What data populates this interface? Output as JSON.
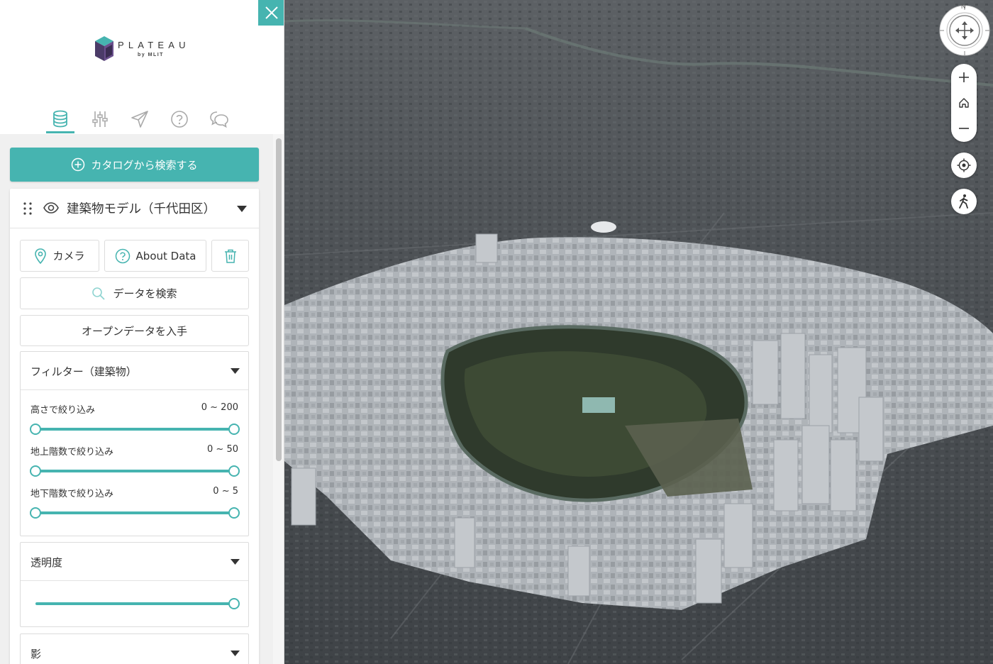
{
  "app": {
    "logo_text": "PLATEAU",
    "logo_sub": "by MLIT"
  },
  "sidebar": {
    "tabs": [
      {
        "icon": "database-icon",
        "active": true
      },
      {
        "icon": "sliders-icon",
        "active": false
      },
      {
        "icon": "send-icon",
        "active": false
      },
      {
        "icon": "help-icon",
        "active": false
      },
      {
        "icon": "chat-icon",
        "active": false
      }
    ],
    "catalog_button": "カタログから検索する"
  },
  "layer": {
    "title": "建築物モデル（千代田区）",
    "camera_label": "カメラ",
    "about_label": "About Data",
    "search_label": "データを検索",
    "opendata_label": "オープンデータを入手",
    "filter": {
      "title": "フィルター（建築物）",
      "sliders": [
        {
          "label": "高さで絞り込み",
          "range": "0 ~ 200",
          "min": 0,
          "max": 200,
          "low": 0,
          "high": 200
        },
        {
          "label": "地上階数で絞り込み",
          "range": "0 ~ 50",
          "min": 0,
          "max": 50,
          "low": 0,
          "high": 50
        },
        {
          "label": "地下階数で絞り込み",
          "range": "0 ~ 5",
          "min": 0,
          "max": 5,
          "low": 0,
          "high": 5
        }
      ]
    },
    "opacity": {
      "title": "透明度",
      "value": 1.0
    },
    "shadow": {
      "title": "影"
    }
  },
  "map_controls": {
    "compass_north": "N",
    "buttons": [
      "zoom-in",
      "home",
      "zoom-out",
      "my-location",
      "pedestrian-mode"
    ]
  },
  "colors": {
    "accent": "#46b4b0",
    "building": "#b9bec3",
    "panel_bg": "#f0f0f0"
  }
}
